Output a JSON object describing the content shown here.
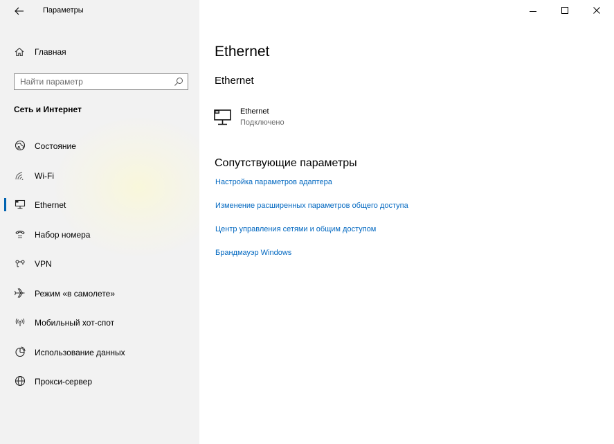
{
  "window": {
    "app_title": "Параметры"
  },
  "sidebar": {
    "home_label": "Главная",
    "search_placeholder": "Найти параметр",
    "section_header": "Сеть и Интернет",
    "items": [
      {
        "label": "Состояние",
        "icon": "globe-status-icon",
        "selected": false
      },
      {
        "label": "Wi-Fi",
        "icon": "wifi-icon",
        "selected": false
      },
      {
        "label": "Ethernet",
        "icon": "ethernet-icon",
        "selected": true
      },
      {
        "label": "Набор номера",
        "icon": "dialup-icon",
        "selected": false
      },
      {
        "label": "VPN",
        "icon": "vpn-icon",
        "selected": false
      },
      {
        "label": "Режим «в самолете»",
        "icon": "airplane-icon",
        "selected": false
      },
      {
        "label": "Мобильный хот-спот",
        "icon": "hotspot-icon",
        "selected": false
      },
      {
        "label": "Использование данных",
        "icon": "data-usage-icon",
        "selected": false
      },
      {
        "label": "Прокси-сервер",
        "icon": "globe-icon",
        "selected": false
      }
    ]
  },
  "main": {
    "page_title": "Ethernet",
    "sub_title": "Ethernet",
    "adapter": {
      "name": "Ethernet",
      "status": "Подключено"
    },
    "related_title": "Сопутствующие параметры",
    "links": [
      "Настройка параметров адаптера",
      "Изменение расширенных параметров общего доступа",
      "Центр управления сетями и общим доступом",
      "Брандмауэр Windows"
    ]
  },
  "colors": {
    "accent": "#0063b1",
    "link": "#0067c0",
    "sidebar_bg": "#f2f2f2"
  }
}
